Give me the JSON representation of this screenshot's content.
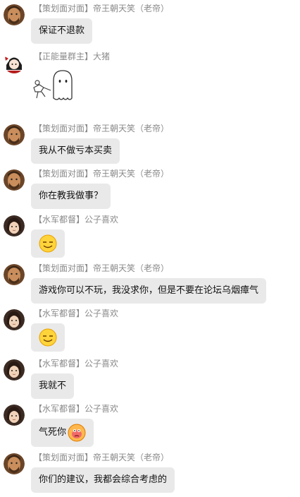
{
  "messages": [
    {
      "sender": "【策划面对面】帝王朝天笑（老帝）",
      "avatar": "bearded-man-avatar",
      "text": "保证不退款"
    },
    {
      "sender": "【正能量群主】大猪",
      "avatar": "anime-girl-avatar",
      "sticker": "ghost-sticker"
    },
    {
      "sender": "【策划面对面】帝王朝天笑（老帝）",
      "avatar": "bearded-man-avatar",
      "text": "我从不做亏本买卖"
    },
    {
      "sender": "【策划面对面】帝王朝天笑（老帝）",
      "avatar": "bearded-man-avatar",
      "text": "你在教我做事？"
    },
    {
      "sender": "【水军都督】公子喜欢",
      "avatar": "long-hair-man-avatar",
      "emoji": "sly-smile-emoji"
    },
    {
      "sender": "【策划面对面】帝王朝天笑（老帝）",
      "avatar": "bearded-man-avatar",
      "text": "游戏你可以不玩，我没求你，但是不要在论坛乌烟瘴气"
    },
    {
      "sender": "【水军都督】公子喜欢",
      "avatar": "long-hair-man-avatar",
      "emoji": "sly-smile-emoji"
    },
    {
      "sender": "【水军都督】公子喜欢",
      "avatar": "long-hair-man-avatar",
      "text": "我就不"
    },
    {
      "sender": "【水军都督】公子喜欢",
      "avatar": "long-hair-man-avatar",
      "text": "气死你",
      "emoji": "angry-face-emoji"
    },
    {
      "sender": "【策划面对面】帝王朝天笑（老帝）",
      "avatar": "bearded-man-avatar",
      "text": "你们的建议，我都会综合考虑的"
    }
  ],
  "colors": {
    "bubble": "#e9e9e9",
    "sender_text": "#8a8a8a",
    "message_text": "#111111"
  }
}
